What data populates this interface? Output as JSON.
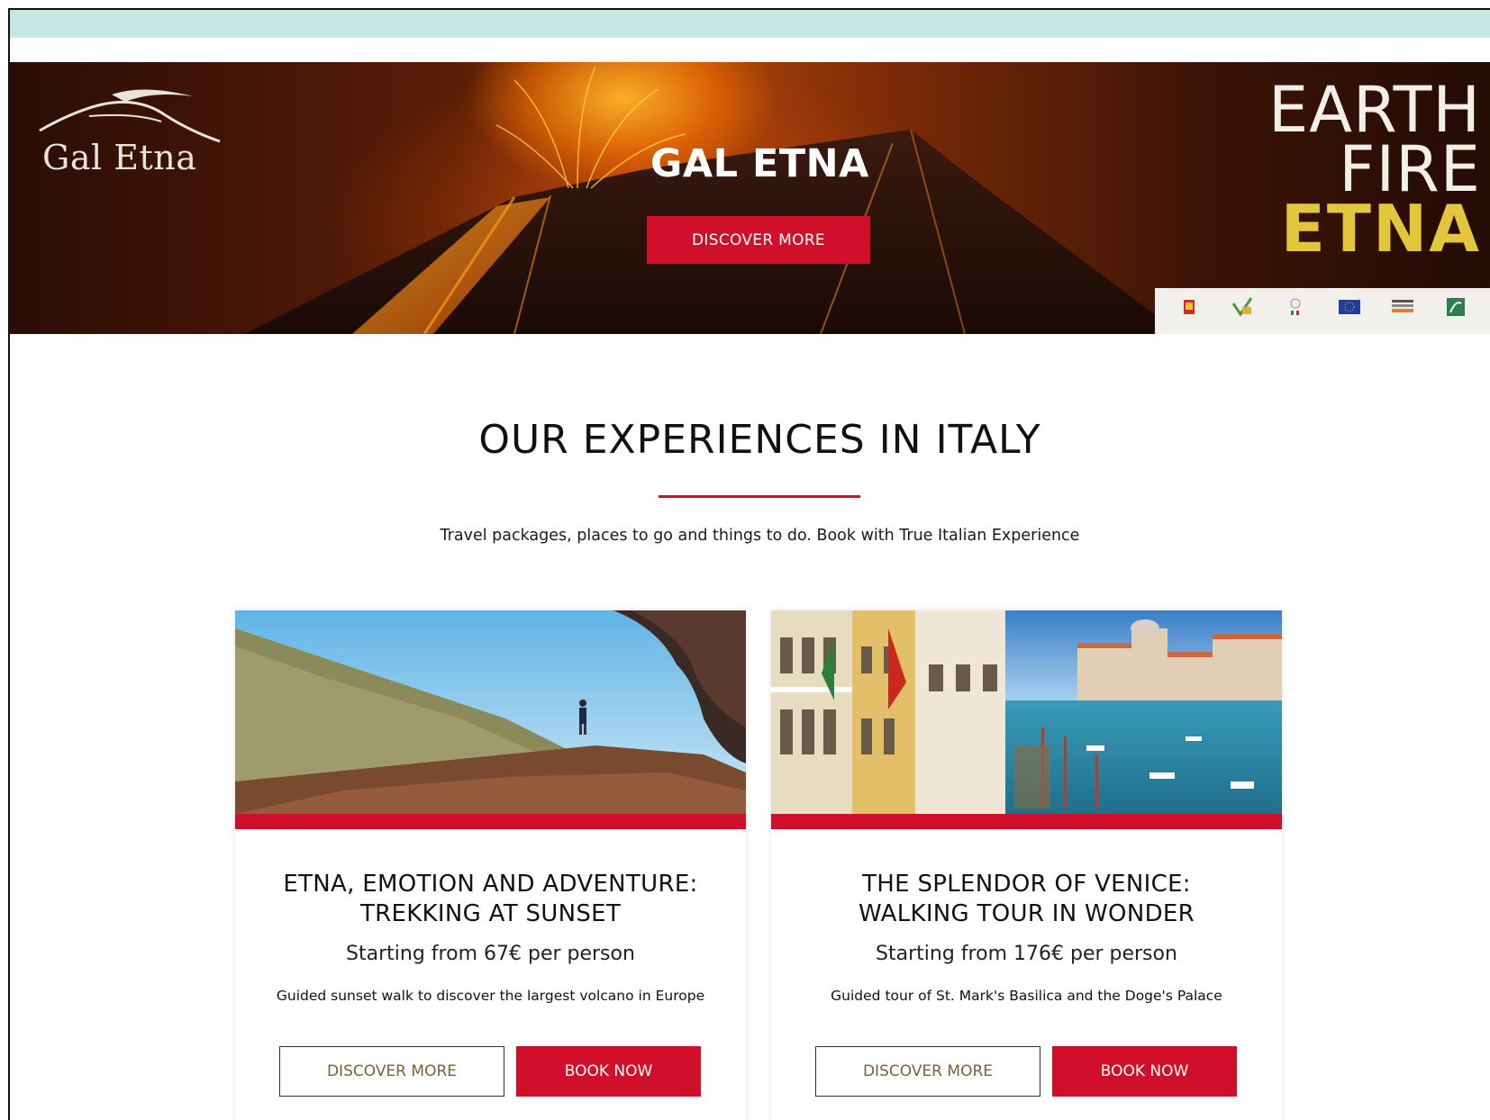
{
  "hero": {
    "logo_text": "Gal Etna",
    "title": "GAL ETNA",
    "cta_label": "DISCOVER MORE",
    "tagline": [
      "EARTH",
      "FIRE",
      "ETNA"
    ],
    "accent_color": "#d0102a",
    "tagline_highlight_color": "#e3c63b"
  },
  "section": {
    "title": "OUR EXPERIENCES IN ITALY",
    "subtitle": "Travel packages, places to go and things to do. Book with True Italian Experience"
  },
  "cards": [
    {
      "title_line1": "ETNA, EMOTION AND ADVENTURE:",
      "title_line2": "TREKKING AT SUNSET",
      "price": "Starting from 67€ per person",
      "description": "Guided sunset walk to discover the largest volcano in Europe",
      "discover_label": "DISCOVER MORE",
      "book_label": "BOOK NOW"
    },
    {
      "title_line1": "THE SPLENDOR OF VENICE:",
      "title_line2": "WALKING TOUR IN WONDER",
      "price": "Starting from 176€ per person",
      "description": "Guided tour of St. Mark's Basilica and the Doge's Palace",
      "discover_label": "DISCOVER MORE",
      "book_label": "BOOK NOW"
    }
  ]
}
